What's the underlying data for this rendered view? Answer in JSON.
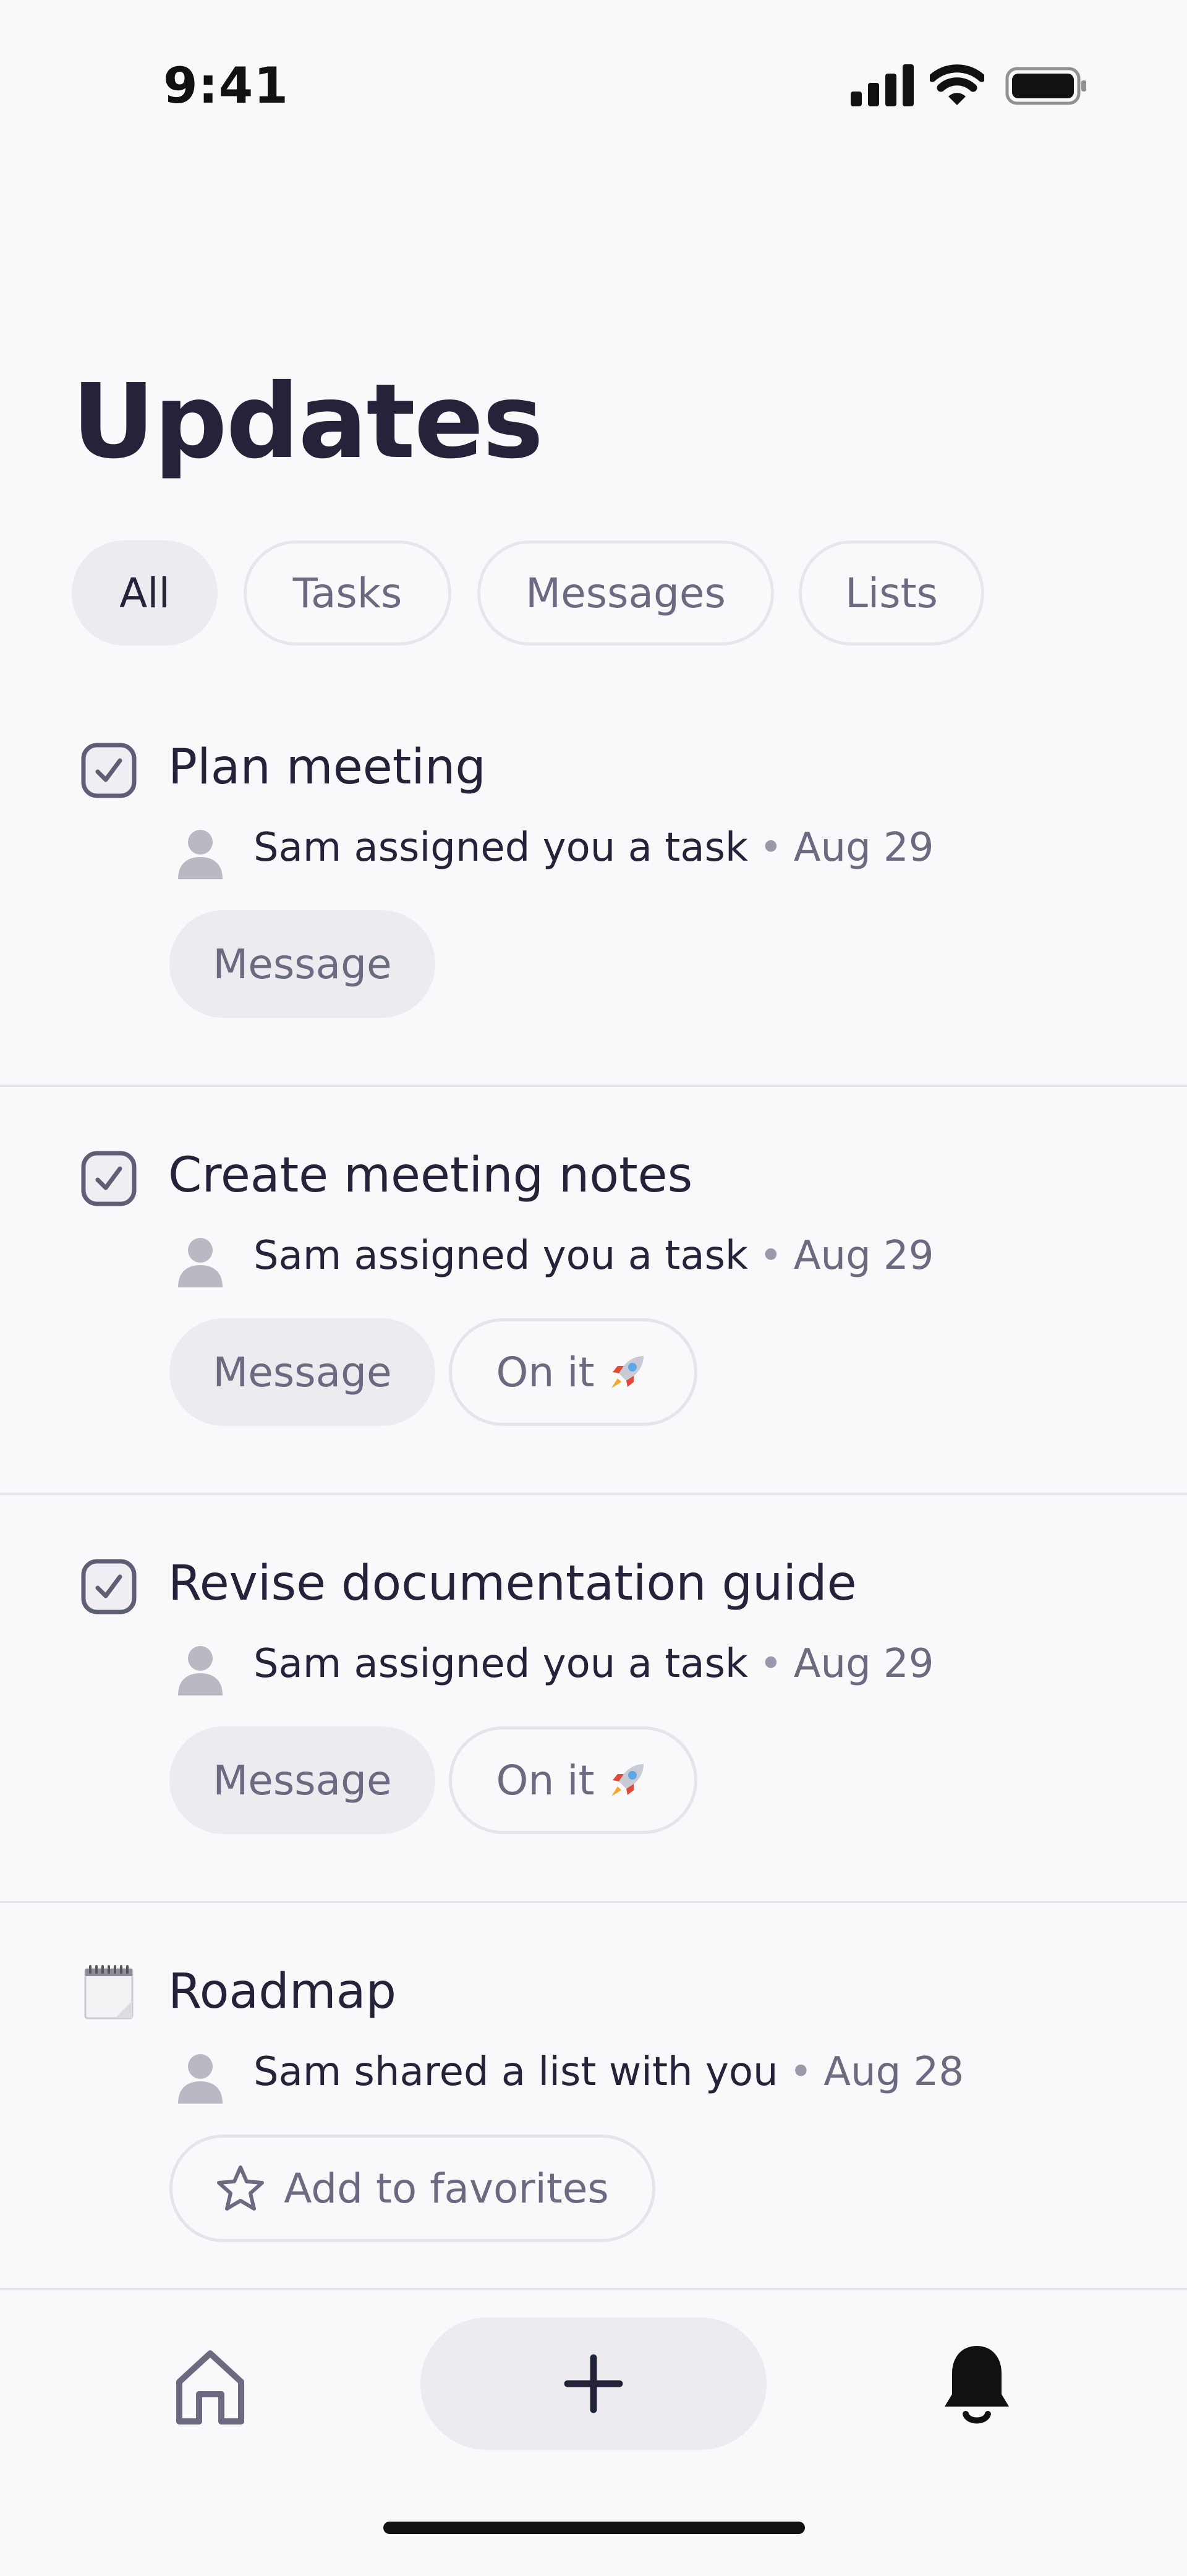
{
  "status": {
    "time": "9:41"
  },
  "header": {
    "title": "Updates"
  },
  "filters": [
    {
      "label": "All",
      "active": true
    },
    {
      "label": "Tasks",
      "active": false
    },
    {
      "label": "Messages",
      "active": false
    },
    {
      "label": "Lists",
      "active": false
    }
  ],
  "feed": [
    {
      "icon": "checkbox-icon",
      "title": "Plan meeting",
      "meta": "Sam assigned you a task",
      "date": "Aug 29",
      "actions": {
        "message": "Message"
      }
    },
    {
      "icon": "checkbox-icon",
      "title": "Create meeting notes",
      "meta": "Sam assigned you a task",
      "date": "Aug 29",
      "actions": {
        "message": "Message",
        "on_it": "On it"
      }
    },
    {
      "icon": "checkbox-icon",
      "title": "Revise documentation guide",
      "meta": "Sam assigned you a task",
      "date": "Aug 29",
      "actions": {
        "message": "Message",
        "on_it": "On it"
      }
    },
    {
      "icon": "notepad-icon",
      "title": "Roadmap",
      "meta": "Sam shared a list with you",
      "date": "Aug 28",
      "actions": {
        "favorite": "Add to favorites"
      }
    }
  ],
  "tabbar": {
    "items": [
      "home-icon",
      "plus-icon",
      "bell-icon"
    ]
  },
  "colors": {
    "background": "#f9f9fb",
    "text": "#24233a",
    "muted": "#6b6a80",
    "chip": "#ebebf0"
  }
}
